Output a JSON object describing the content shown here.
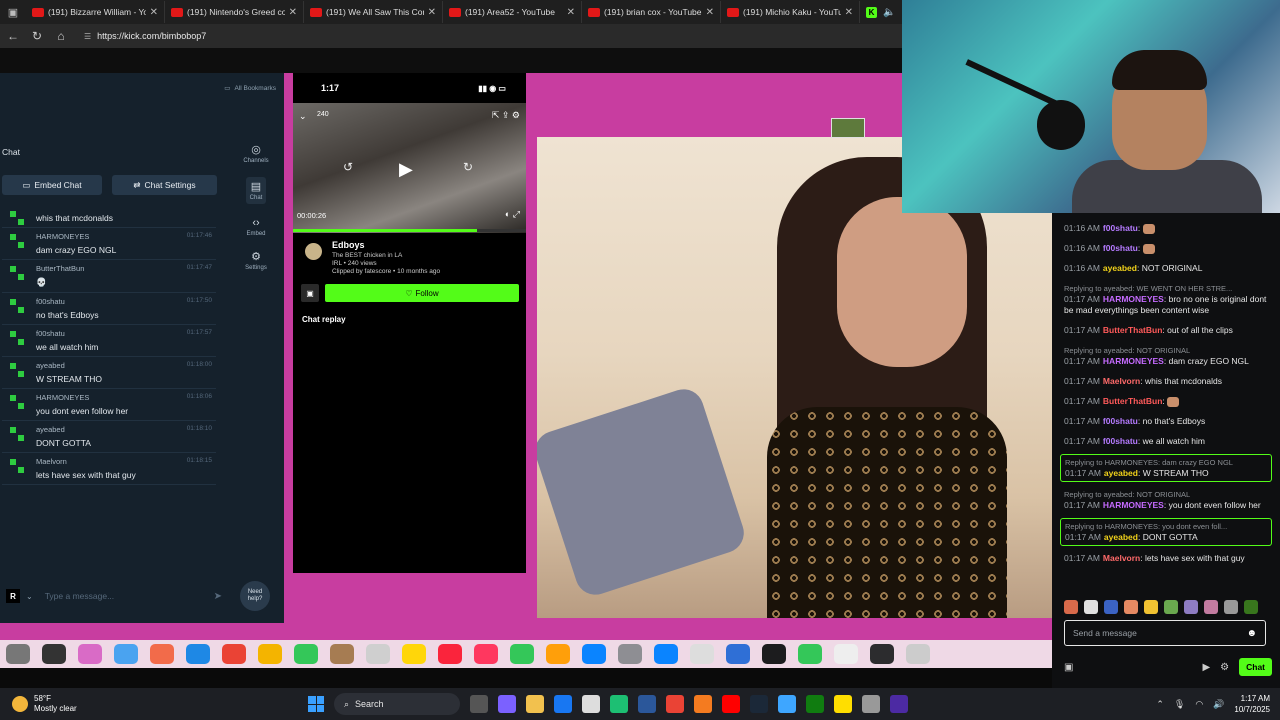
{
  "browser": {
    "tabs": [
      {
        "title": "(191) Bizzarre William - Yo"
      },
      {
        "title": "(191) Nintendo's Greed co"
      },
      {
        "title": "(191) We All Saw This Com"
      },
      {
        "title": "(191) Area52 - YouTube"
      },
      {
        "title": "(191) brian cox - YouTube"
      },
      {
        "title": "(191) Michio Kaku - YouTub"
      }
    ],
    "active_tab_letter": "K",
    "url": "https://kick.com/bimbobop7"
  },
  "left_panel": {
    "bookmarks_label": "All Bookmarks",
    "title": "Chat",
    "embed_chat_label": "Embed Chat",
    "chat_settings_label": "Chat Settings",
    "side": [
      {
        "label": "Channels",
        "icon": "broadcast-icon"
      },
      {
        "label": "Chat",
        "icon": "chat-icon"
      },
      {
        "label": "Embed",
        "icon": "code-icon"
      },
      {
        "label": "Settings",
        "icon": "gear-icon"
      }
    ],
    "messages": [
      {
        "user": "",
        "time": "",
        "text": "whis that mcdonalds"
      },
      {
        "user": "HARMONEYES",
        "time": "01:17:46",
        "text": "dam crazy EGO NGL"
      },
      {
        "user": "ButterThatBun",
        "time": "01:17:47",
        "text": "💀"
      },
      {
        "user": "f00shatu",
        "time": "01:17:50",
        "text": "no that's Edboys"
      },
      {
        "user": "f00shatu",
        "time": "01:17:57",
        "text": "we all watch him"
      },
      {
        "user": "ayeabed",
        "time": "01:18:00",
        "text": "W STREAM THO"
      },
      {
        "user": "HARMONEYES",
        "time": "01:18:06",
        "text": "you dont even follow her"
      },
      {
        "user": "ayeabed",
        "time": "01:18:10",
        "text": "DONT GOTTA"
      },
      {
        "user": "Maelvorn",
        "time": "01:18:15",
        "text": "lets have sex with that guy"
      }
    ],
    "input_placeholder": "Type a message...",
    "need_help": "Need help?"
  },
  "phone": {
    "time": "1:17",
    "viewers": "240",
    "video_time": "00:00:26",
    "progress": 0.79,
    "channel": "Edboys",
    "headline": "The BEST chicken in LA",
    "meta": "IRL • 240 views",
    "clipped": "Clipped by fatescore • 10 months ago",
    "follow": "Follow",
    "chat_replay": "Chat replay"
  },
  "kick_chat": {
    "messages": [
      {
        "time": "01:16 AM",
        "user": "f00shatu",
        "color": "#b57bff",
        "text": "",
        "emoji": true
      },
      {
        "time": "01:16 AM",
        "user": "f00shatu",
        "color": "#b57bff",
        "text": "",
        "emoji": true
      },
      {
        "time": "01:16 AM",
        "user": "ayeabed",
        "color": "#f2d31b",
        "text": "NOT ORIGINAL"
      },
      {
        "reply": "Replying to ayeabed: WE WENT ON HER STRE...",
        "time": "01:17 AM",
        "user": "HARMONEYES",
        "color": "#c56bff",
        "text": "bro no one is original dont be mad everythings been content wise"
      },
      {
        "time": "01:17 AM",
        "user": "ButterThatBun",
        "color": "#ff5a5a",
        "text": "out of all the clips"
      },
      {
        "reply": "Replying to ayeabed: NOT ORIGINAL",
        "time": "01:17 AM",
        "user": "HARMONEYES",
        "color": "#c56bff",
        "text": "dam crazy EGO NGL"
      },
      {
        "time": "01:17 AM",
        "user": "Maelvorn",
        "color": "#ff6a6a",
        "text": "whis that mcdonalds"
      },
      {
        "time": "01:17 AM",
        "user": "ButterThatBun",
        "color": "#ff5a5a",
        "text": "",
        "emoji": true
      },
      {
        "time": "01:17 AM",
        "user": "f00shatu",
        "color": "#b57bff",
        "text": "no that's Edboys"
      },
      {
        "time": "01:17 AM",
        "user": "f00shatu",
        "color": "#b57bff",
        "text": "we all watch him"
      },
      {
        "reply": "Replying to HARMONEYES: dam crazy EGO NGL",
        "time": "01:17 AM",
        "user": "ayeabed",
        "color": "#f2d31b",
        "text": "W STREAM THO",
        "highlight": true
      },
      {
        "reply": "Replying to ayeabed: NOT ORIGINAL",
        "time": "01:17 AM",
        "user": "HARMONEYES",
        "color": "#c56bff",
        "text": "you dont even follow her"
      },
      {
        "reply": "Replying to HARMONEYES: you dont even foll...",
        "time": "01:17 AM",
        "user": "ayeabed",
        "color": "#f2d31b",
        "text": "DONT GOTTA",
        "highlight": true
      },
      {
        "time": "01:17 AM",
        "user": "Maelvorn",
        "color": "#ff6a6a",
        "text": "lets have sex with that guy"
      }
    ],
    "input_placeholder": "Send a message",
    "chat_button": "Chat"
  },
  "taskbar": {
    "temp": "58°F",
    "weather": "Mostly clear",
    "search": "Search",
    "time": "1:17 AM",
    "date": "10/7/2025"
  },
  "colors": {
    "kick_green": "#53fc18",
    "pink_bg": "#c83da0"
  }
}
